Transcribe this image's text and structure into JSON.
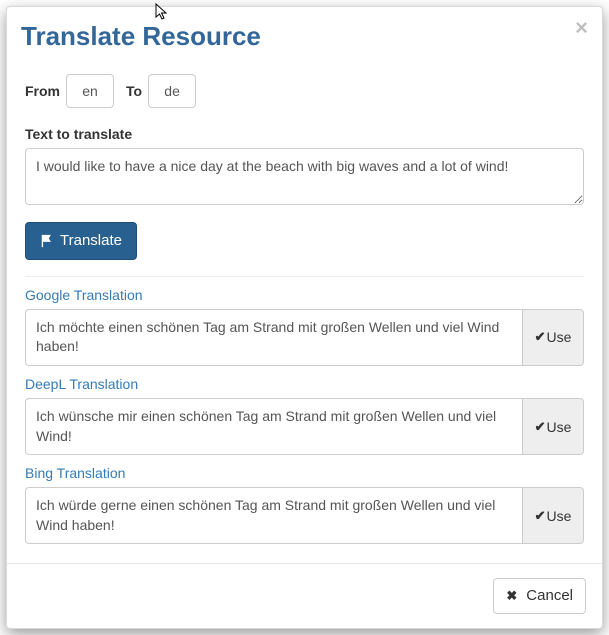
{
  "modal": {
    "title": "Translate Resource",
    "close": "×"
  },
  "lang": {
    "from_label": "From",
    "from_value": "en",
    "to_label": "To",
    "to_value": "de"
  },
  "input": {
    "label": "Text to translate",
    "value": "I would like to have a nice day at the beach with big waves and a lot of wind!"
  },
  "translate_button": "Translate",
  "use_label": "Use",
  "providers": [
    {
      "name": "Google Translation",
      "result": "Ich möchte einen schönen Tag am Strand mit großen Wellen und viel Wind haben!"
    },
    {
      "name": "DeepL Translation",
      "result": "Ich wünsche mir einen schönen Tag am Strand mit großen Wellen und viel Wind!"
    },
    {
      "name": "Bing Translation",
      "result": "Ich würde gerne einen schönen Tag am Strand mit großen Wellen und viel Wind haben!"
    }
  ],
  "footer": {
    "cancel": "Cancel"
  }
}
